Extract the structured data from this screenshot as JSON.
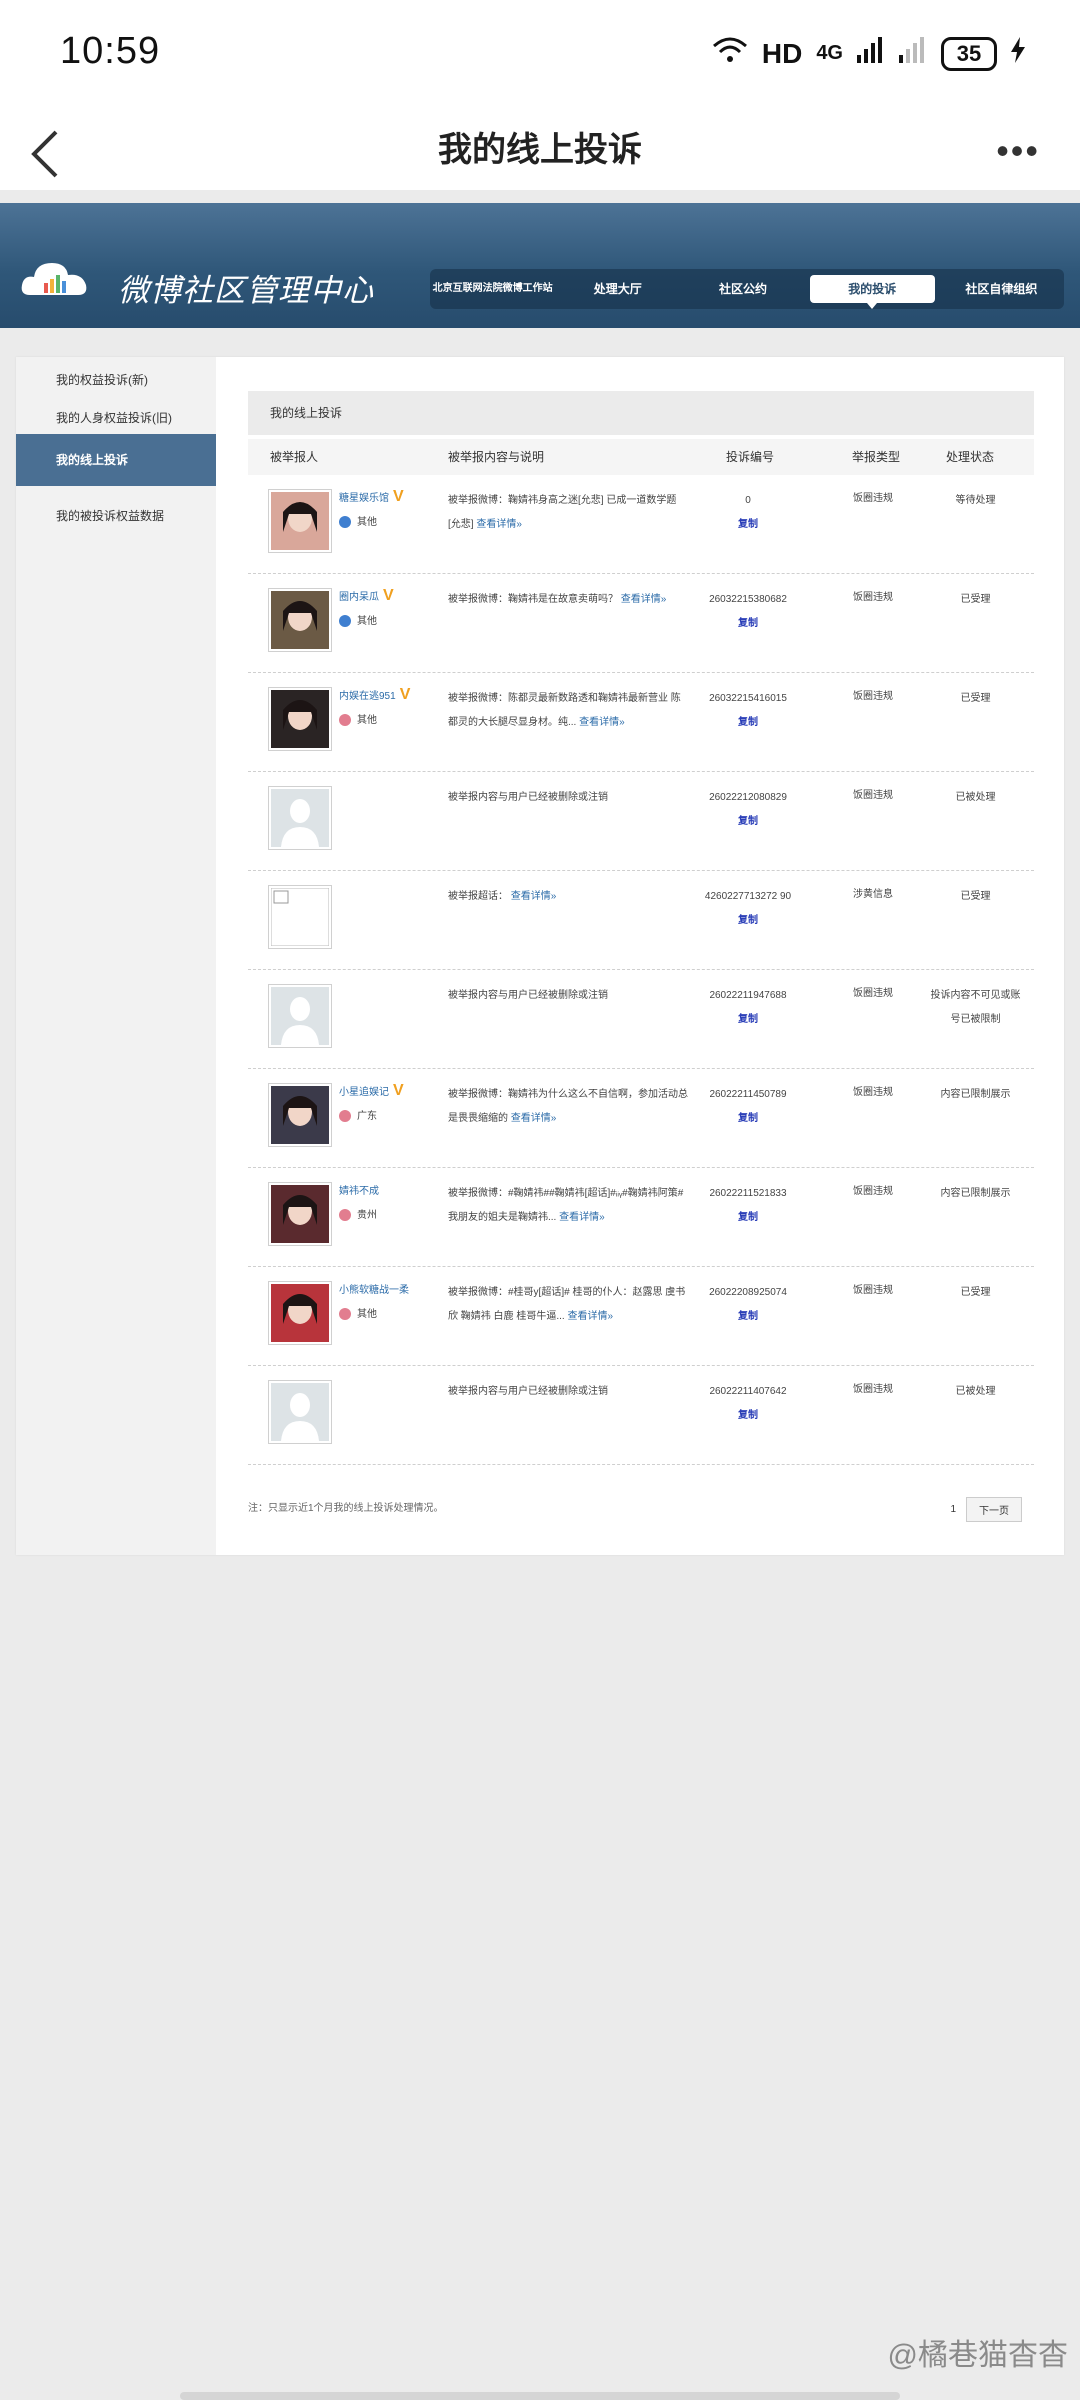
{
  "status_bar": {
    "time": "10:59",
    "network": "HD",
    "signal": "4G",
    "battery": "35"
  },
  "app": {
    "title": "我的线上投诉",
    "more": "•••"
  },
  "banner": {
    "brand": "微博社区管理中心",
    "nav": [
      {
        "label": "北京互联网法院微博工作站",
        "active": false
      },
      {
        "label": "处理大厅",
        "active": false
      },
      {
        "label": "社区公约",
        "active": false
      },
      {
        "label": "我的投诉",
        "active": true
      },
      {
        "label": "社区自律组织",
        "active": false
      }
    ]
  },
  "sidebar": [
    {
      "label": "我的权益投诉(新)"
    },
    {
      "label": "我的人身权益投诉(旧)"
    },
    {
      "label": "我的线上投诉",
      "active": true
    },
    {
      "label": "我的被投诉权益数据"
    }
  ],
  "section_title": "我的线上投诉",
  "table_headers": [
    "被举报人",
    "被举报内容与说明",
    "投诉编号",
    "举报类型",
    "处理状态"
  ],
  "rows": [
    {
      "name": "糖星娱乐馆",
      "verified": true,
      "location": "其他",
      "gender": "male",
      "avatar_color": "#d9a79a",
      "desc": "被举报微博：鞠婧祎身高之迷[允悲] 已成一道数学题[允悲]",
      "link": "查看详情»",
      "id": "0",
      "copy": "复制",
      "type": "饭圈违规",
      "status": "等待处理"
    },
    {
      "name": "圈内呆瓜",
      "verified": true,
      "location": "其他",
      "gender": "male",
      "avatar_color": "#6b5a45",
      "desc": "被举报微博：鞠婧祎是在故意卖萌吗？",
      "link": "查看详情»",
      "id": "26032215380682",
      "copy": "复制",
      "type": "饭圈违规",
      "status": "已受理"
    },
    {
      "name": "内娱在逃951",
      "verified": true,
      "location": "其他",
      "gender": "female",
      "avatar_color": "#2a2424",
      "desc": "被举报微博：陈都灵最新数路透和鞠婧祎最新营业 陈都灵的大长腿尽显身材。纯...",
      "link": "查看详情»",
      "id": "26032215416015",
      "copy": "复制",
      "type": "饭圈违规",
      "status": "已受理"
    },
    {
      "name": "",
      "verified": false,
      "location": "",
      "gender": "",
      "avatar_color": "placeholder",
      "desc": "被举报内容与用户已经被删除或注销",
      "link": "",
      "id": "26022212080829",
      "copy": "复制",
      "type": "饭圈违规",
      "status": "已被处理"
    },
    {
      "name": "",
      "verified": false,
      "location": "",
      "gender": "",
      "avatar_color": "blank",
      "desc": "被举报超话：",
      "link": "查看详情»",
      "id": "4260227713272 90",
      "copy": "复制",
      "type": "涉黄信息",
      "status": "已受理"
    },
    {
      "name": "",
      "verified": false,
      "location": "",
      "gender": "",
      "avatar_color": "placeholder",
      "desc": "被举报内容与用户已经被删除或注销",
      "link": "",
      "id": "26022211947688",
      "copy": "复制",
      "type": "饭圈违规",
      "status": "投诉内容不可见或账号已被限制"
    },
    {
      "name": "小星追娱记",
      "verified": true,
      "location": "广东",
      "gender": "female",
      "avatar_color": "#3b3a4a",
      "desc": "被举报微博：鞠婧祎为什么这么不自信啊，参加活动总是畏畏缩缩的",
      "link": "查看详情»",
      "id": "26022211450789",
      "copy": "复制",
      "type": "饭圈违规",
      "status": "内容已限制展示"
    },
    {
      "name": "婧祎不成",
      "verified": false,
      "location": "贵州",
      "gender": "female",
      "avatar_color": "#5a2a2e",
      "desc": "被举报微博：#鞠婧祎##鞠婧祎[超话]#ᵢᵢᵧ#鞠婧祎阿策# 我朋友的姐夫是鞠婧祎...",
      "link": "查看详情»",
      "id": "26022211521833",
      "copy": "复制",
      "type": "饭圈违规",
      "status": "内容已限制展示"
    },
    {
      "name": "小熊软糖战一柔",
      "verified": false,
      "location": "其他",
      "gender": "female",
      "avatar_color": "#b8343b",
      "desc": "被举报微博：#桂哥y[超话]# 桂哥的仆人：赵露思 虞书欣 鞠婧祎 白鹿 桂哥牛逼...",
      "link": "查看详情»",
      "id": "26022208925074",
      "copy": "复制",
      "type": "饭圈违规",
      "status": "已受理"
    },
    {
      "name": "",
      "verified": false,
      "location": "",
      "gender": "",
      "avatar_color": "placeholder",
      "desc": "被举报内容与用户已经被删除或注销",
      "link": "",
      "id": "26022211407642",
      "copy": "复制",
      "type": "饭圈违规",
      "status": "已被处理"
    }
  ],
  "footer_note": "注：只显示近1个月我的线上投诉处理情况。",
  "pager": {
    "page": "1",
    "next": "下一页"
  },
  "watermark": "@橘巷猫杳杳"
}
